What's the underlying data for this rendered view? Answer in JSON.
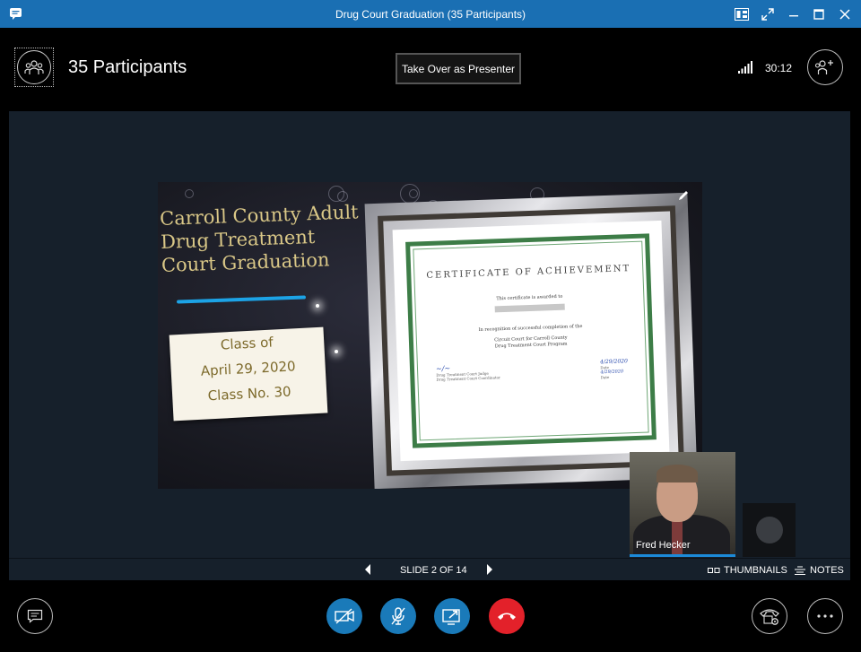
{
  "window": {
    "title": "Drug Court Graduation (35 Participants)"
  },
  "header": {
    "participants_label": "35 Participants",
    "presenter_button": "Take Over as Presenter",
    "timer": "30:12"
  },
  "slide": {
    "title_lines": [
      "Carroll County Adult",
      "Drug Treatment",
      "Court Graduation"
    ],
    "card_lines": [
      "Class of",
      "April 29, 2020",
      "Class No. 30"
    ],
    "certificate": {
      "title": "CERTIFICATE OF ACHIEVEMENT",
      "awarded": "This certificate is awarded to",
      "recognition": "In recognition of successful completion of the",
      "court_line1": "Circuit Court for Carroll County",
      "court_line2": "Drug Treatment Court Program",
      "sig1_label": "Drug Treatment Court Judge",
      "sig2_label": "Drug Treatment Court Coordinator",
      "date1": "4/29/2020",
      "date2": "4/29/2020",
      "date_label": "Date"
    }
  },
  "video": {
    "name": "Fred Hecker"
  },
  "navbar": {
    "slide_count": "SLIDE 2 OF 14",
    "thumbnails": "THUMBNAILS",
    "notes": "NOTES"
  },
  "colors": {
    "titlebar": "#1a6fb3",
    "accent_blue": "#1a7ab9",
    "hangup_red": "#e3212a",
    "stage": "#16202b",
    "slide_gold": "#d9c787"
  }
}
